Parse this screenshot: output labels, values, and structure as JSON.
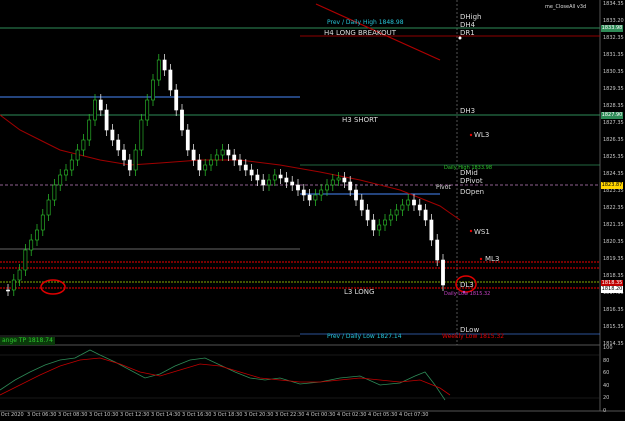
{
  "indicator_name": "me_CloseAll v3d",
  "price_axis": [
    "1834.35",
    "1833.20",
    "1832.35",
    "1831.35",
    "1830.35",
    "1829.35",
    "1828.35",
    "1827.35",
    "1826.35",
    "1825.35",
    "1824.35",
    "1823.35",
    "1822.35",
    "1821.35",
    "1820.35",
    "1819.35",
    "1818.35",
    "1817.35",
    "1816.35",
    "1815.35",
    "1814.35"
  ],
  "price_tags": {
    "dh4": "1833.98",
    "h3": "1827.90",
    "pivot": "1823.87",
    "l3": "1818.35",
    "current": "1818.20"
  },
  "osc_axis": [
    "100",
    "80",
    "60",
    "40",
    "20",
    "0"
  ],
  "time_axis": [
    "3 Oct 2020",
    "3 Oct 06:30",
    "3 Oct 08:30",
    "3 Oct 10:30",
    "3 Oct 12:30",
    "3 Oct 14:30",
    "3 Oct 16:30",
    "3 Oct 18:30",
    "3 Oct 20:30",
    "3 Oct 22:30",
    "4 Oct 00:30",
    "4 Oct 02:30",
    "4 Oct 05:30",
    "4 Oct 07:30"
  ],
  "level_labels": {
    "dhigh": "DHigh",
    "dh4": "DH4",
    "dr1": "DR1",
    "dh3": "DH3",
    "wl3": "WL3",
    "dmid": "DMid",
    "dpivot": "DPivot",
    "dopen": "DOpen",
    "pivot": "Pivot",
    "ws1": "WS1",
    "ml3": "ML3",
    "dl3": "DL3",
    "dlow": "DLow"
  },
  "annotations": {
    "prev_daily_high": "Prev / Daily High 1848.98",
    "h4_long_breakout": "H4 LONG BREAKOUT",
    "h3_short": "H3 SHORT",
    "daily_high": "Daily High 1833.98",
    "l3_long": "L3 LONG",
    "daily_low_small": "Daily Low 1815.32",
    "prev_daily_low": "Prev / Daily Low 1827.14",
    "weekly_low": "Weekly Low 1815.32"
  },
  "lower_left_label": "ange TP 1818.74",
  "colors": {
    "bull": "#2ec82e",
    "bear": "#ffffff",
    "level_white": "#c8c8c8",
    "level_green": "#2e8b57",
    "level_red": "#c00000",
    "level_blue": "#3a6ec8",
    "annotation_cyan": "#26c6d8",
    "magenta": "#c040c0"
  }
}
